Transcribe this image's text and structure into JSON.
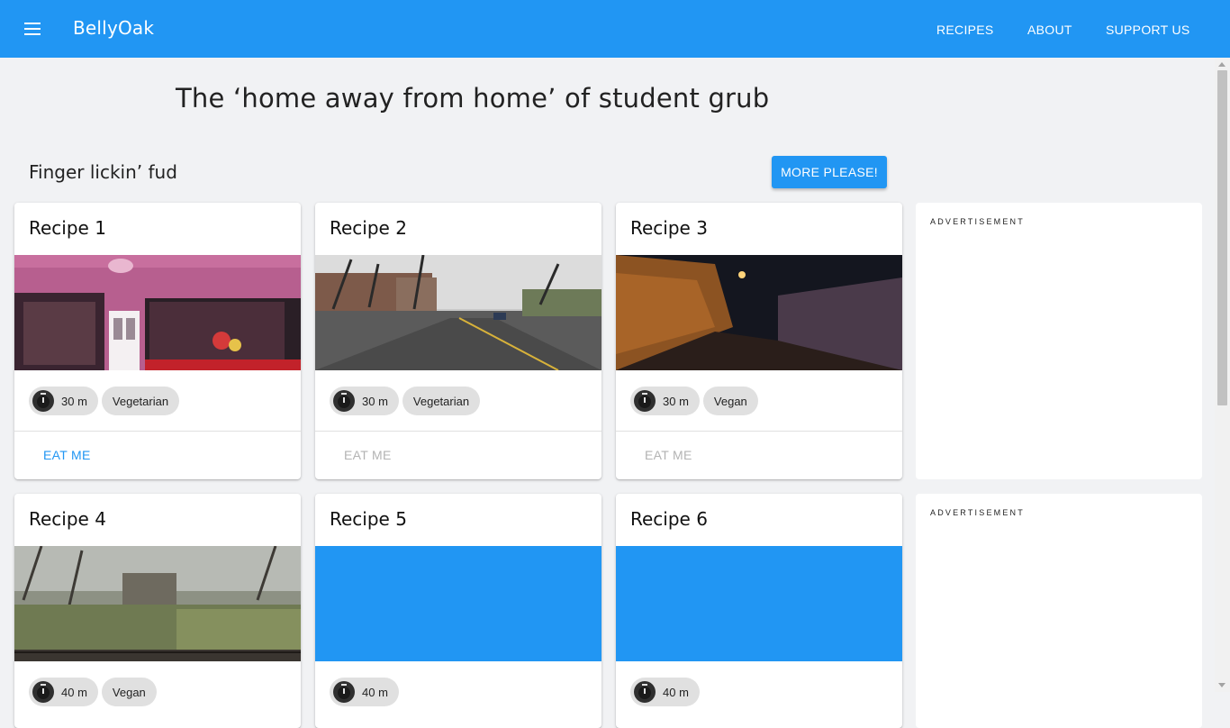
{
  "appbar": {
    "brand": "BellyOak",
    "nav": [
      "RECIPES",
      "ABOUT",
      "SUPPORT US"
    ],
    "color": "#2196f3"
  },
  "tagline": "The ‘home away from home’ of student grub",
  "section": {
    "title": "Finger lickin’ fud",
    "more_button": "MORE PLEASE!"
  },
  "recipes": [
    {
      "title": "Recipe 1",
      "time": "30 m",
      "tag": "Vegetarian",
      "action": "EAT ME",
      "action_state": "active",
      "image": "pink-shopfront"
    },
    {
      "title": "Recipe 2",
      "time": "30 m",
      "tag": "Vegetarian",
      "action": "EAT ME",
      "action_state": "disabled",
      "image": "wet-street"
    },
    {
      "title": "Recipe 3",
      "time": "30 m",
      "tag": "Vegan",
      "action": "EAT ME",
      "action_state": "disabled",
      "image": "night-alley"
    },
    {
      "title": "Recipe 4",
      "time": "40 m",
      "tag": "Vegan",
      "image": "snowy-garden"
    },
    {
      "title": "Recipe 5",
      "time": "40 m",
      "image": "blue-placeholder"
    },
    {
      "title": "Recipe 6",
      "time": "40 m",
      "image": "blue-placeholder"
    }
  ],
  "ads": [
    "ADVERTISEMENT",
    "ADVERTISEMENT"
  ]
}
